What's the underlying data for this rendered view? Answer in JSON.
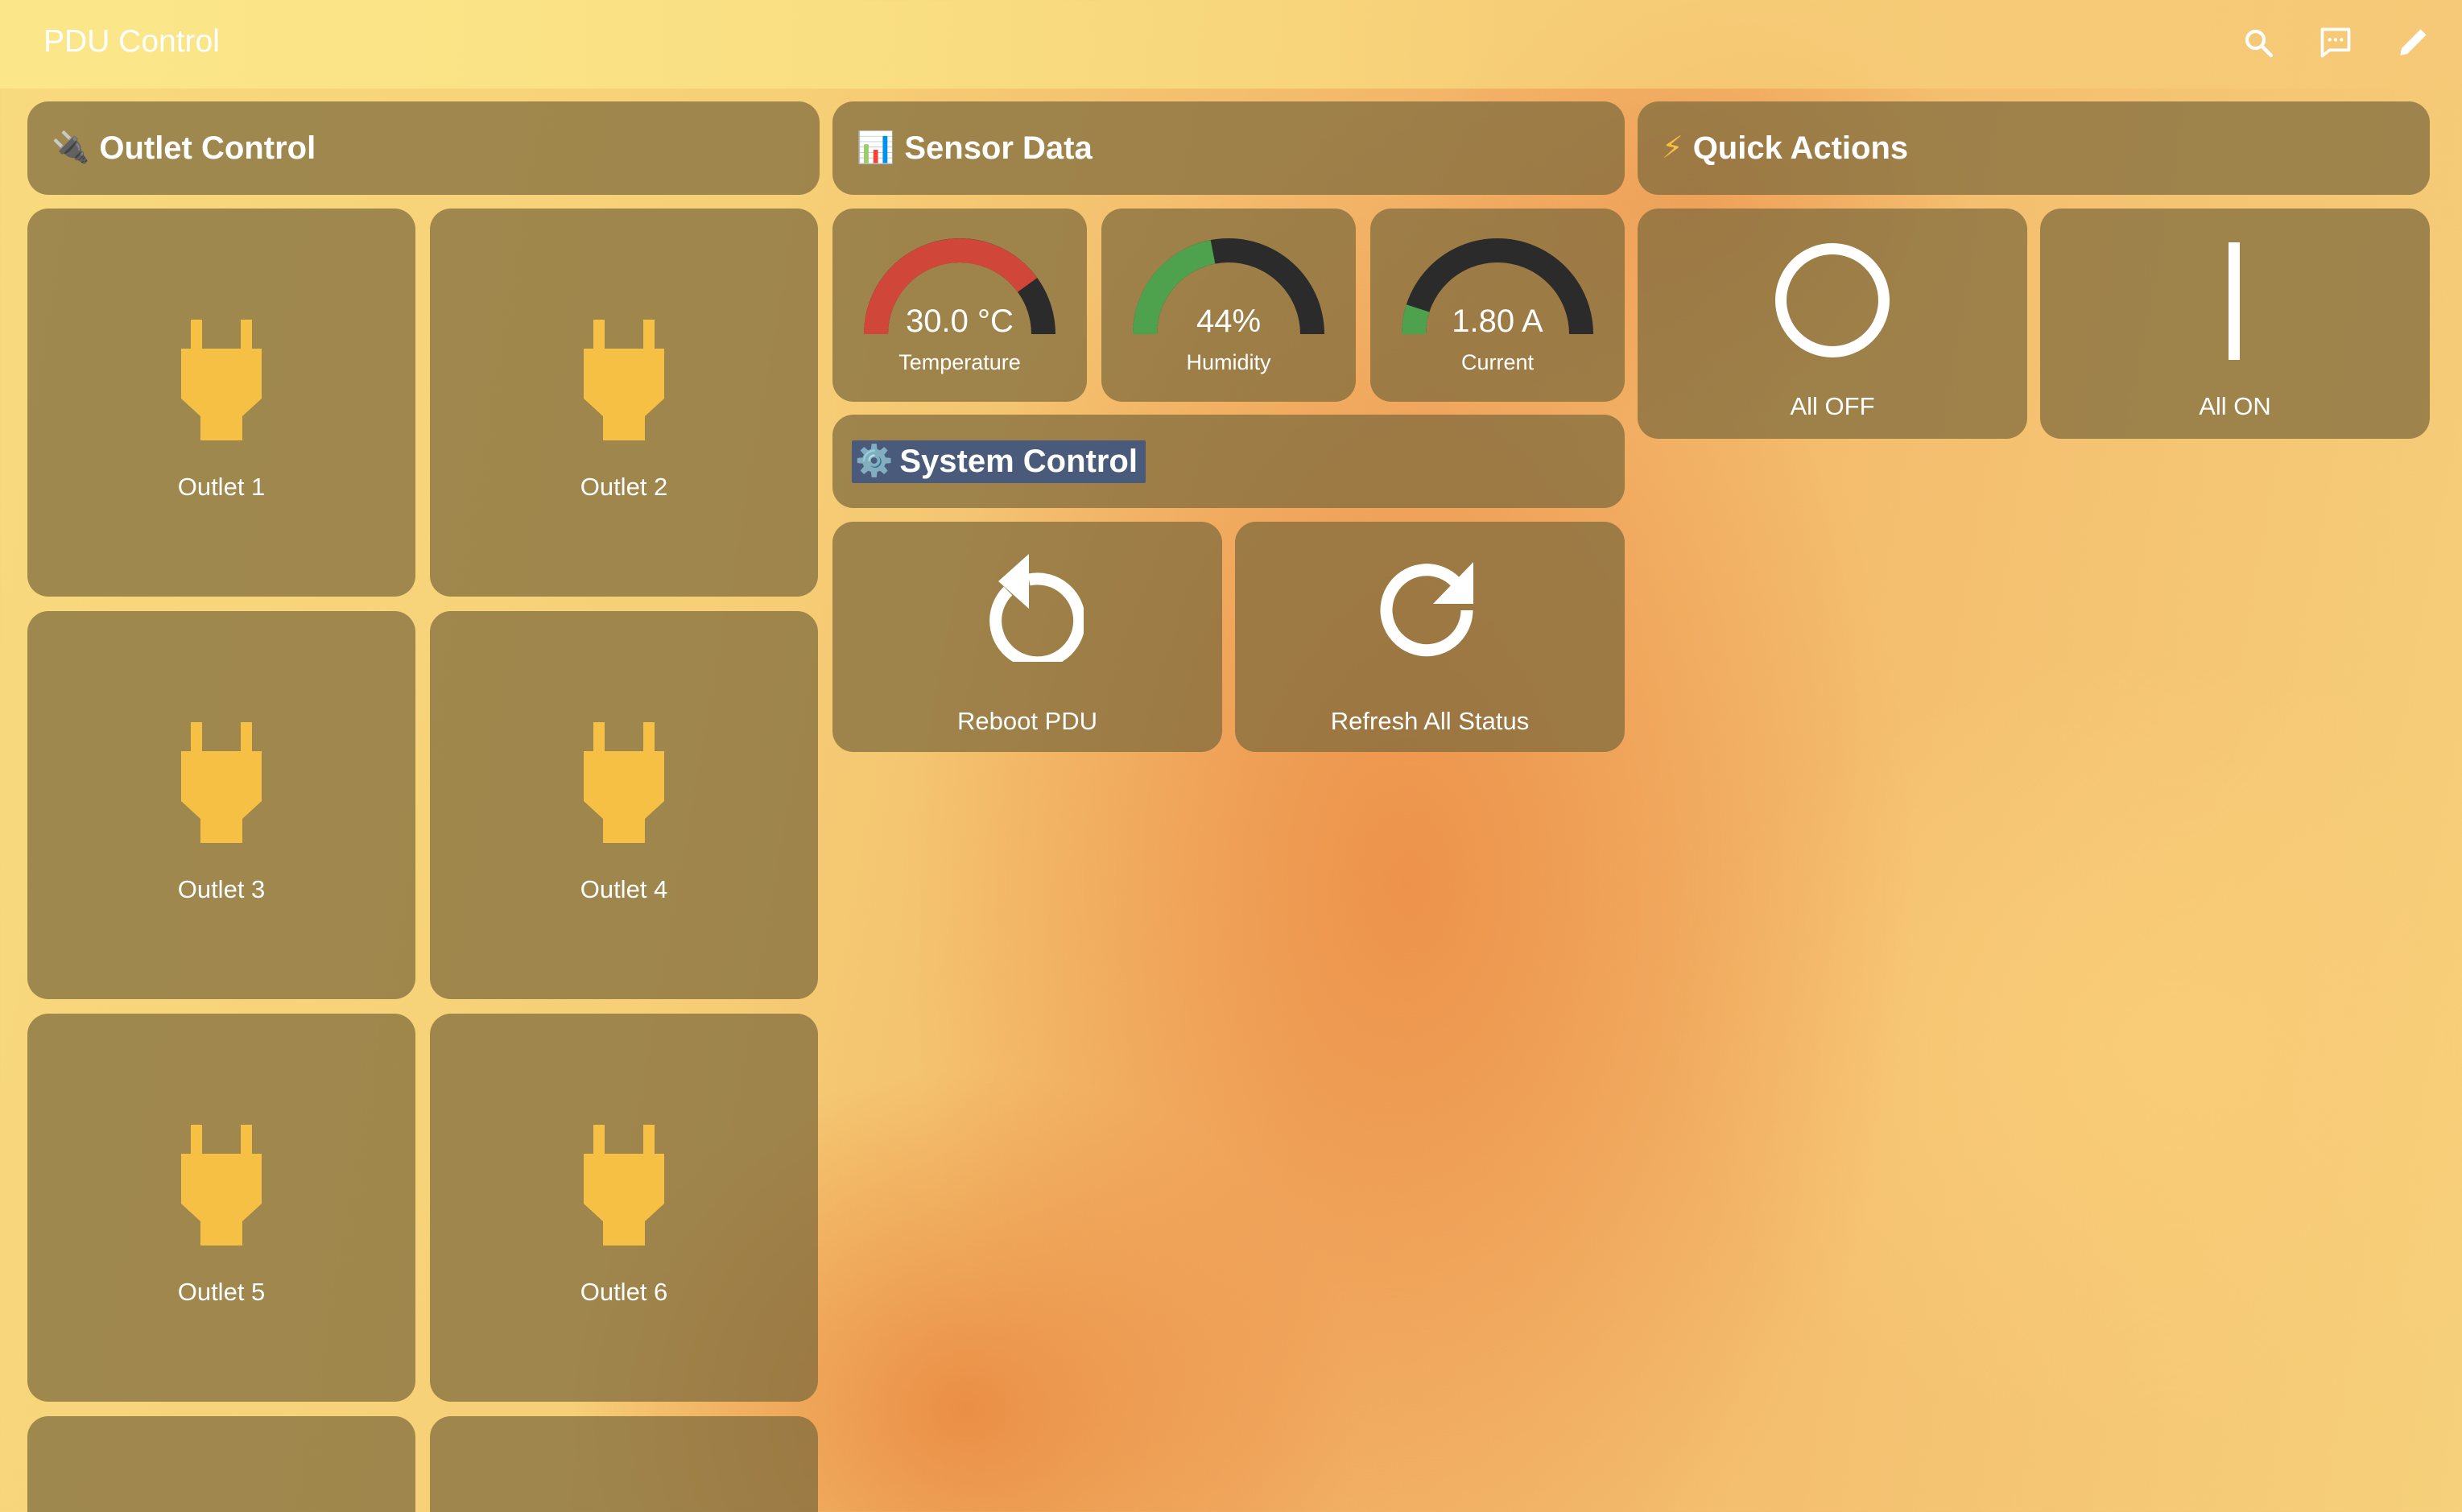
{
  "app": {
    "title": "PDU Control",
    "toolbar_icons": [
      "search-icon",
      "chat-icon",
      "pencil-icon"
    ]
  },
  "sections": {
    "outlets": {
      "emoji": "🔌",
      "title": "Outlet Control"
    },
    "sensors": {
      "emoji": "📊",
      "title": "Sensor Data"
    },
    "quick": {
      "emoji": "⚡",
      "title": "Quick Actions"
    },
    "system": {
      "emoji": "⚙️",
      "title": "System Control"
    }
  },
  "outlets": [
    {
      "label": "Outlet 1"
    },
    {
      "label": "Outlet 2"
    },
    {
      "label": "Outlet 3"
    },
    {
      "label": "Outlet 4"
    },
    {
      "label": "Outlet 5"
    },
    {
      "label": "Outlet 6"
    }
  ],
  "sensors": [
    {
      "value": "30.0 °C",
      "label": "Temperature",
      "fraction": 0.8,
      "color": "#d0473a"
    },
    {
      "value": "44%",
      "label": "Humidity",
      "fraction": 0.44,
      "color": "#4ea24e"
    },
    {
      "value": "1.80 A",
      "label": "Current",
      "fraction": 0.1,
      "color": "#4ea24e"
    }
  ],
  "system_actions": [
    {
      "label": "Reboot PDU",
      "icon": "restart-icon"
    },
    {
      "label": "Refresh All Status",
      "icon": "refresh-icon"
    }
  ],
  "quick_actions": [
    {
      "label": "All OFF",
      "icon": "power-off-circle-icon"
    },
    {
      "label": "All ON",
      "icon": "power-on-line-icon"
    }
  ],
  "colors": {
    "card": "#7d693c",
    "outlet_icon": "#f5c043",
    "gauge_track": "#2b2b2b",
    "text": "#ffffff"
  }
}
